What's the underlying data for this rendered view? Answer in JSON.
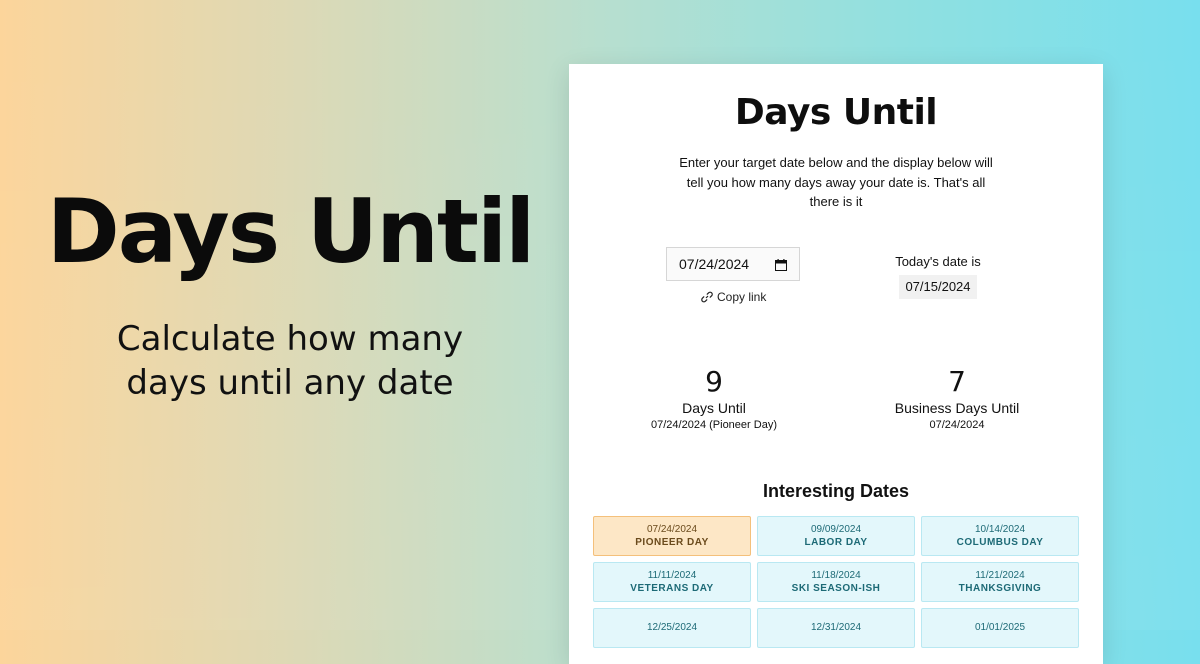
{
  "hero": {
    "title": "Days Until",
    "subtitle": "Calculate how many days until any date"
  },
  "card": {
    "title": "Days Until",
    "description": "Enter your target date below and the display below will tell you how many days away your date is. That's all there is it",
    "target_date_value": "07/24/2024",
    "copy_link_label": "Copy link",
    "today_label": "Today's date is",
    "today_value": "07/15/2024",
    "stats": {
      "days_until": {
        "number": "9",
        "label": "Days Until",
        "date": "07/24/2024 (Pioneer Day)"
      },
      "business_days_until": {
        "number": "7",
        "label": "Business Days Until",
        "date": "07/24/2024"
      }
    },
    "interesting_title": "Interesting Dates",
    "interesting_dates": [
      {
        "date": "07/24/2024",
        "name": "PIONEER DAY",
        "active": true
      },
      {
        "date": "09/09/2024",
        "name": "LABOR DAY",
        "active": false
      },
      {
        "date": "10/14/2024",
        "name": "COLUMBUS DAY",
        "active": false
      },
      {
        "date": "11/11/2024",
        "name": "VETERANS DAY",
        "active": false
      },
      {
        "date": "11/18/2024",
        "name": "SKI SEASON-ISH",
        "active": false
      },
      {
        "date": "11/21/2024",
        "name": "THANKSGIVING",
        "active": false
      },
      {
        "date": "12/25/2024",
        "name": "",
        "active": false
      },
      {
        "date": "12/31/2024",
        "name": "",
        "active": false
      },
      {
        "date": "01/01/2025",
        "name": "",
        "active": false
      }
    ]
  },
  "colors": {
    "chip_bg": "#e3f7fb",
    "chip_border": "#b9e8f2",
    "chip_text": "#1d6a76",
    "chip_active_bg": "#fde7c6",
    "chip_active_border": "#f4c07b"
  },
  "icons": {
    "date_input": "calendar-icon",
    "copy_link": "link-icon"
  }
}
